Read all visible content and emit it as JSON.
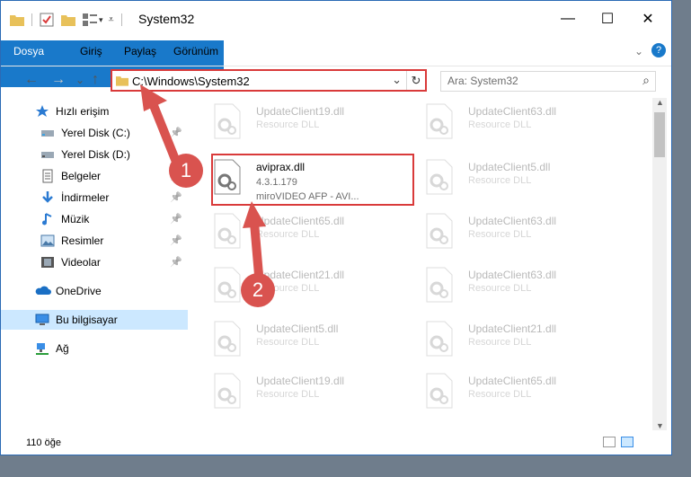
{
  "window": {
    "title": "System32",
    "minimize": "—",
    "maximize": "☐",
    "close": "✕"
  },
  "ribbon": {
    "tabs": [
      "Dosya",
      "Giriş",
      "Paylaş",
      "Görünüm"
    ],
    "help": "?"
  },
  "nav": {
    "back": "←",
    "forward": "→",
    "recent": "⌄",
    "up": "↑",
    "address": "C:\\Windows\\System32",
    "dropdown": "⌄",
    "refresh": "↻",
    "search_placeholder": "Ara: System32",
    "search_icon": "⌕"
  },
  "sidebar": {
    "items": [
      {
        "label": "Hızlı erişim",
        "icon": "star-icon",
        "pinned": false
      },
      {
        "label": "Yerel Disk (C:)",
        "icon": "drive-icon",
        "pinned": true
      },
      {
        "label": "Yerel Disk (D:)",
        "icon": "drive-icon",
        "pinned": false
      },
      {
        "label": "Belgeler",
        "icon": "documents-icon",
        "pinned": true
      },
      {
        "label": "İndirmeler",
        "icon": "downloads-icon",
        "pinned": true
      },
      {
        "label": "Müzik",
        "icon": "music-icon",
        "pinned": true
      },
      {
        "label": "Resimler",
        "icon": "pictures-icon",
        "pinned": true
      },
      {
        "label": "Videolar",
        "icon": "videos-icon",
        "pinned": true
      },
      {
        "label": "OneDrive",
        "icon": "onedrive-icon",
        "pinned": false
      },
      {
        "label": "Bu bilgisayar",
        "icon": "computer-icon",
        "pinned": false,
        "selected": true
      },
      {
        "label": "Ağ",
        "icon": "network-icon",
        "pinned": false
      }
    ],
    "pin_glyph": "📌"
  },
  "files": {
    "left": [
      {
        "name": "UpdateClient19.dll",
        "desc": "Resource DLL"
      },
      {
        "name": "aviprax.dll",
        "desc": "4.3.1.179",
        "desc2": "miroVIDEO AFP - AVI...",
        "highlight": true
      },
      {
        "name": "UpdateClient65.dll",
        "desc": "Resource DLL"
      },
      {
        "name": "UpdateClient21.dll",
        "desc": "Resource DLL"
      },
      {
        "name": "UpdateClient5.dll",
        "desc": "Resource DLL"
      },
      {
        "name": "UpdateClient19.dll",
        "desc": "Resource DLL"
      }
    ],
    "right": [
      {
        "name": "UpdateClient63.dll",
        "desc": "Resource DLL"
      },
      {
        "name": "UpdateClient5.dll",
        "desc": "Resource DLL"
      },
      {
        "name": "UpdateClient63.dll",
        "desc": "Resource DLL"
      },
      {
        "name": "UpdateClient63.dll",
        "desc": "Resource DLL"
      },
      {
        "name": "UpdateClient21.dll",
        "desc": "Resource DLL"
      },
      {
        "name": "UpdateClient65.dll",
        "desc": "Resource DLL"
      }
    ]
  },
  "status": {
    "count": "110 öğe"
  },
  "annotations": {
    "badge1": "1",
    "badge2": "2",
    "color": "#d9534f"
  }
}
